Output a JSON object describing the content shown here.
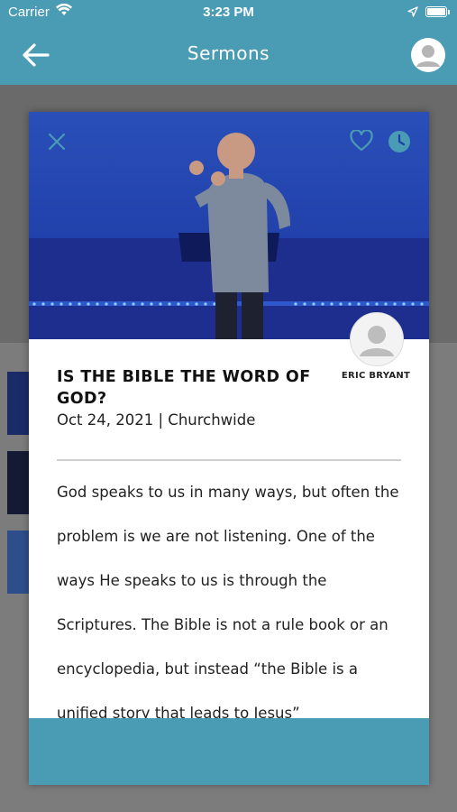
{
  "status_bar": {
    "carrier": "Carrier",
    "time": "3:23 PM"
  },
  "header": {
    "title": "Sermons"
  },
  "sermon": {
    "title": "IS THE BIBLE THE WORD OF GOD?",
    "meta": "Oct 24, 2021 | Churchwide",
    "speaker": "ERIC BRYANT",
    "description": "God speaks to us in many ways, but often the problem is we are not listening. One of the ways He speaks to us is through the Scriptures. The Bible is not a rule book or an encyclopedia, but instead “the Bible is a unified story that leads to Jesus”"
  },
  "icons": {
    "back": "arrow-left-icon",
    "profile": "user-avatar-icon",
    "close": "close-icon",
    "favorite": "heart-icon",
    "watch_later": "clock-icon",
    "wifi": "wifi-icon",
    "location": "location-arrow-icon",
    "battery": "battery-icon"
  },
  "colors": {
    "accent": "#4a9bb4",
    "video_bg": "#1c3fa6"
  }
}
